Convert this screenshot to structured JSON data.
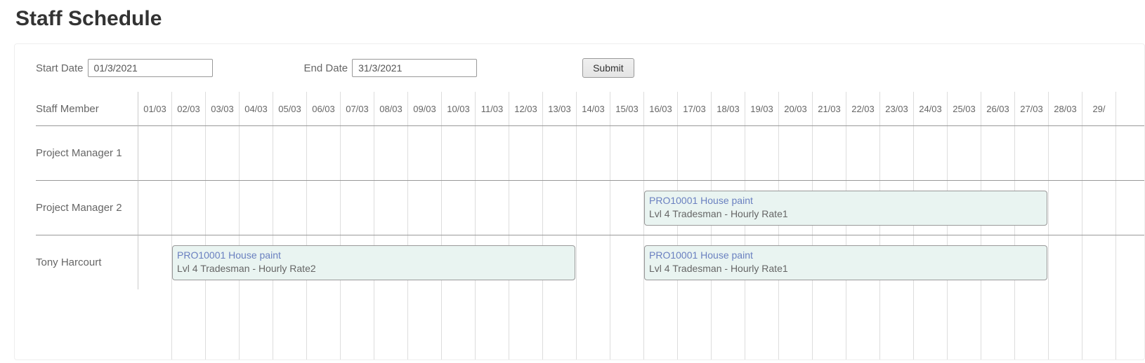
{
  "title": "Staff Schedule",
  "filter": {
    "startDateLabel": "Start Date",
    "startDateValue": "01/3/2021",
    "endDateLabel": "End Date",
    "endDateValue": "31/3/2021",
    "submitLabel": "Submit"
  },
  "columns": {
    "staffMemberLabel": "Staff Member",
    "dates": [
      "01/03",
      "02/03",
      "03/03",
      "04/03",
      "05/03",
      "06/03",
      "07/03",
      "08/03",
      "09/03",
      "10/03",
      "11/03",
      "12/03",
      "13/03",
      "14/03",
      "15/03",
      "16/03",
      "17/03",
      "18/03",
      "19/03",
      "20/03",
      "21/03",
      "22/03",
      "23/03",
      "24/03",
      "25/03",
      "26/03",
      "27/03",
      "28/03",
      "29/"
    ]
  },
  "staff": [
    {
      "name": "Project Manager 1"
    },
    {
      "name": "Project Manager 2"
    },
    {
      "name": "Tony Harcourt"
    }
  ],
  "tasks": [
    {
      "rowIndex": 1,
      "startCol": 15,
      "spanCols": 12,
      "title": "PRO10001 House paint",
      "desc": "Lvl 4 Tradesman - Hourly Rate1"
    },
    {
      "rowIndex": 2,
      "startCol": 1,
      "spanCols": 12,
      "title": "PRO10001 House paint",
      "desc": "Lvl 4 Tradesman - Hourly Rate2"
    },
    {
      "rowIndex": 2,
      "startCol": 15,
      "spanCols": 12,
      "title": "PRO10001 House paint",
      "desc": "Lvl 4 Tradesman - Hourly Rate1"
    }
  ]
}
